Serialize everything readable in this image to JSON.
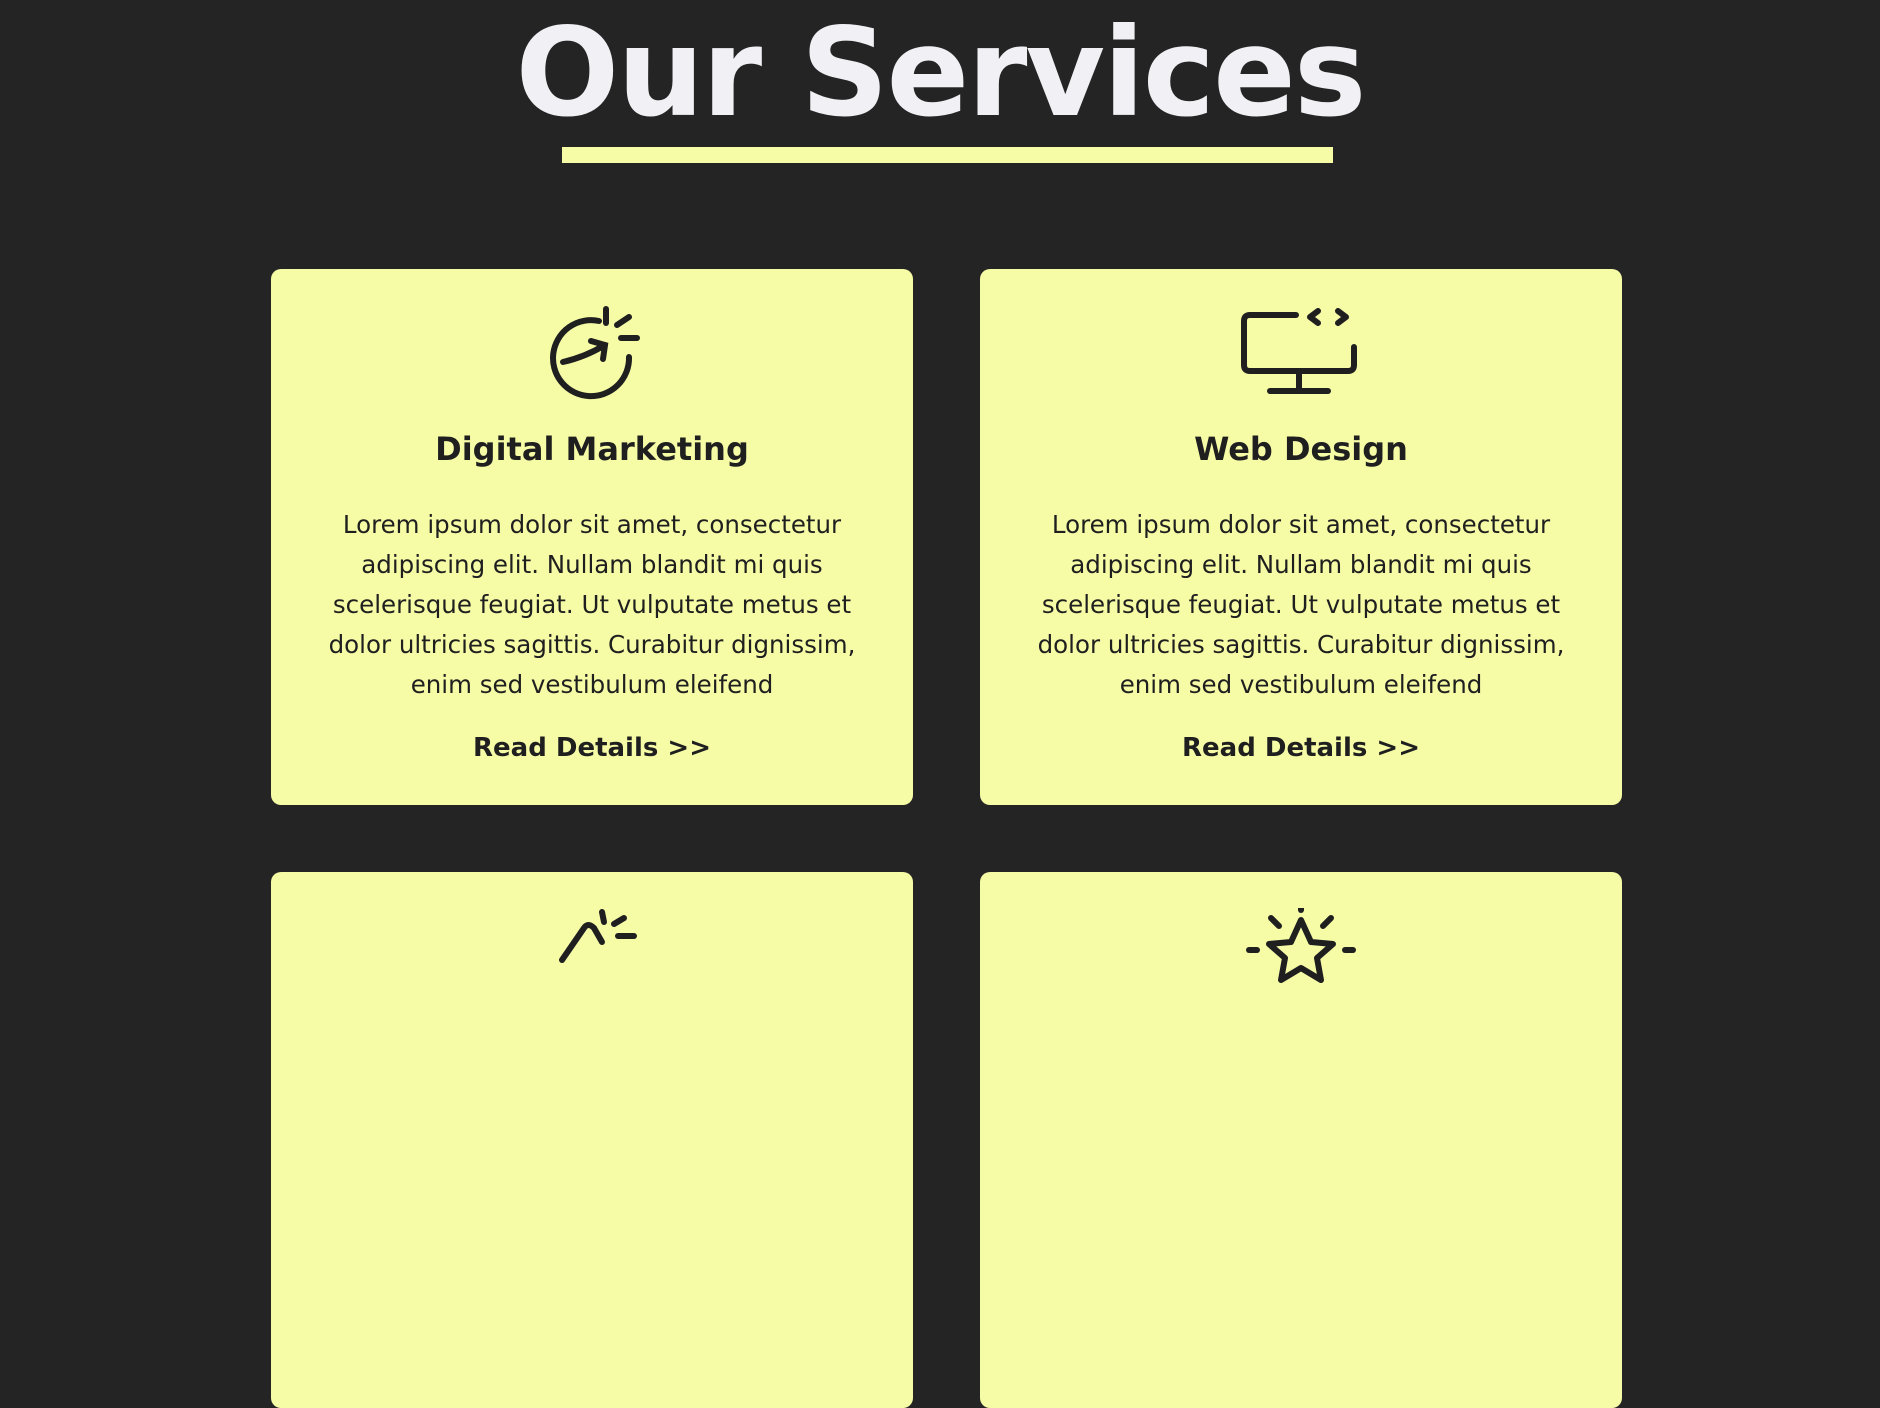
{
  "header": {
    "title": "Our Services"
  },
  "colors": {
    "background": "#242424",
    "accent": "#f6fba6",
    "title": "#f0f0f5",
    "text": "#1f1f1f"
  },
  "services": [
    {
      "icon": "growth-chart-icon",
      "title": "Digital Marketing",
      "description": "Lorem ipsum dolor sit amet, consectetur adipiscing elit. Nullam blandit mi quis scelerisque feugiat. Ut vulputate metus et dolor ultricies sagittis. Curabitur dignissim, enim sed vestibulum eleifend",
      "link_label": "Read Details >>"
    },
    {
      "icon": "monitor-code-icon",
      "title": "Web Design",
      "description": "Lorem ipsum dolor sit amet, consectetur adipiscing elit. Nullam blandit mi quis scelerisque feugiat. Ut vulputate metus et dolor ultricies sagittis. Curabitur dignissim, enim sed vestibulum eleifend",
      "link_label": "Read Details >>"
    },
    {
      "icon": "megaphone-icon"
    },
    {
      "icon": "star-icon"
    }
  ]
}
